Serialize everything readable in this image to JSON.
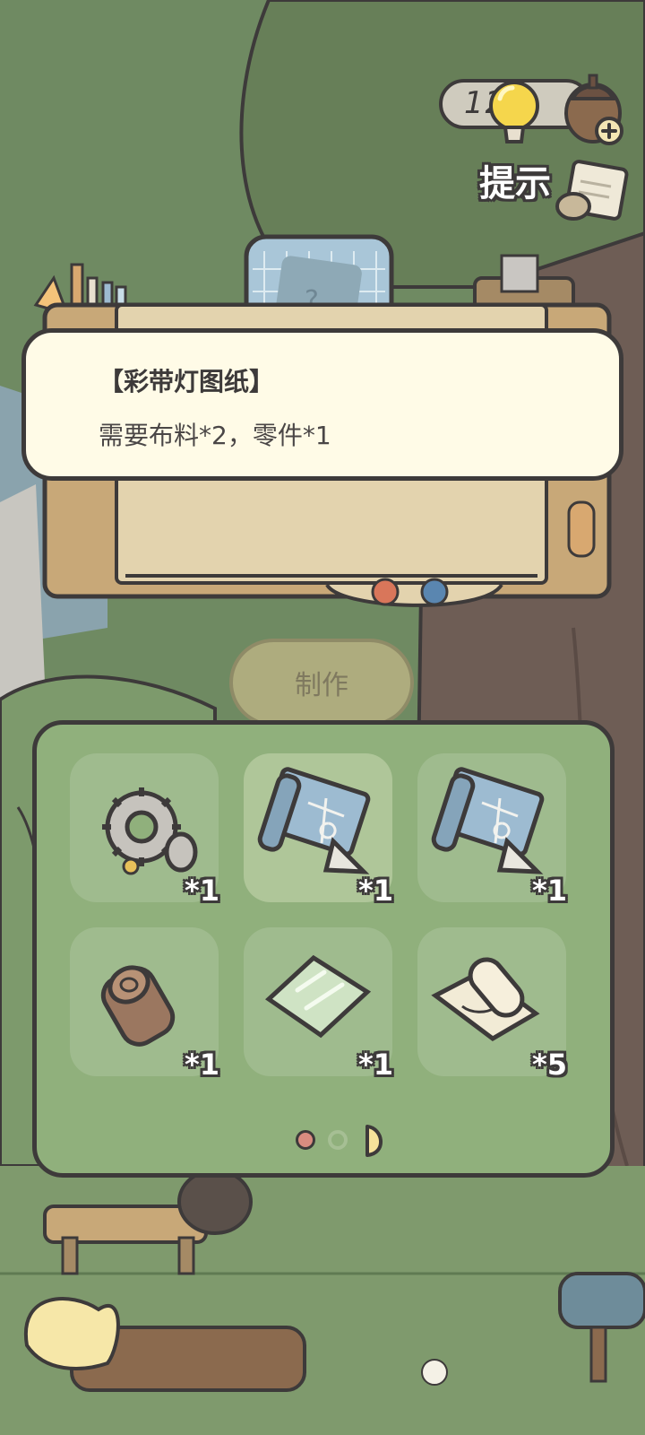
{
  "hud": {
    "hint_count": "12",
    "hint_label": "提示"
  },
  "recipe": {
    "title": "【彩带灯图纸】",
    "requirement": "需要布料*2，零件*1"
  },
  "make_button": {
    "label": "制作",
    "enabled": false
  },
  "inventory": {
    "items": [
      {
        "icon": "gear-part-icon",
        "qty": "*1",
        "selected": false
      },
      {
        "icon": "blueprint-icon",
        "qty": "*1",
        "selected": true
      },
      {
        "icon": "blueprint-icon",
        "qty": "*1",
        "selected": false
      },
      {
        "icon": "wood-log-icon",
        "qty": "*1",
        "selected": false
      },
      {
        "icon": "glass-pane-icon",
        "qty": "*1",
        "selected": false
      },
      {
        "icon": "fabric-roll-icon",
        "qty": "*5",
        "selected": false
      }
    ],
    "pages": 3,
    "current_page": 1
  },
  "colors": {
    "outline": "#3d3a3a",
    "panel_green": "#90b07c",
    "bubble_cream": "#fffbe7",
    "page_dot_active": "#d98c80"
  }
}
